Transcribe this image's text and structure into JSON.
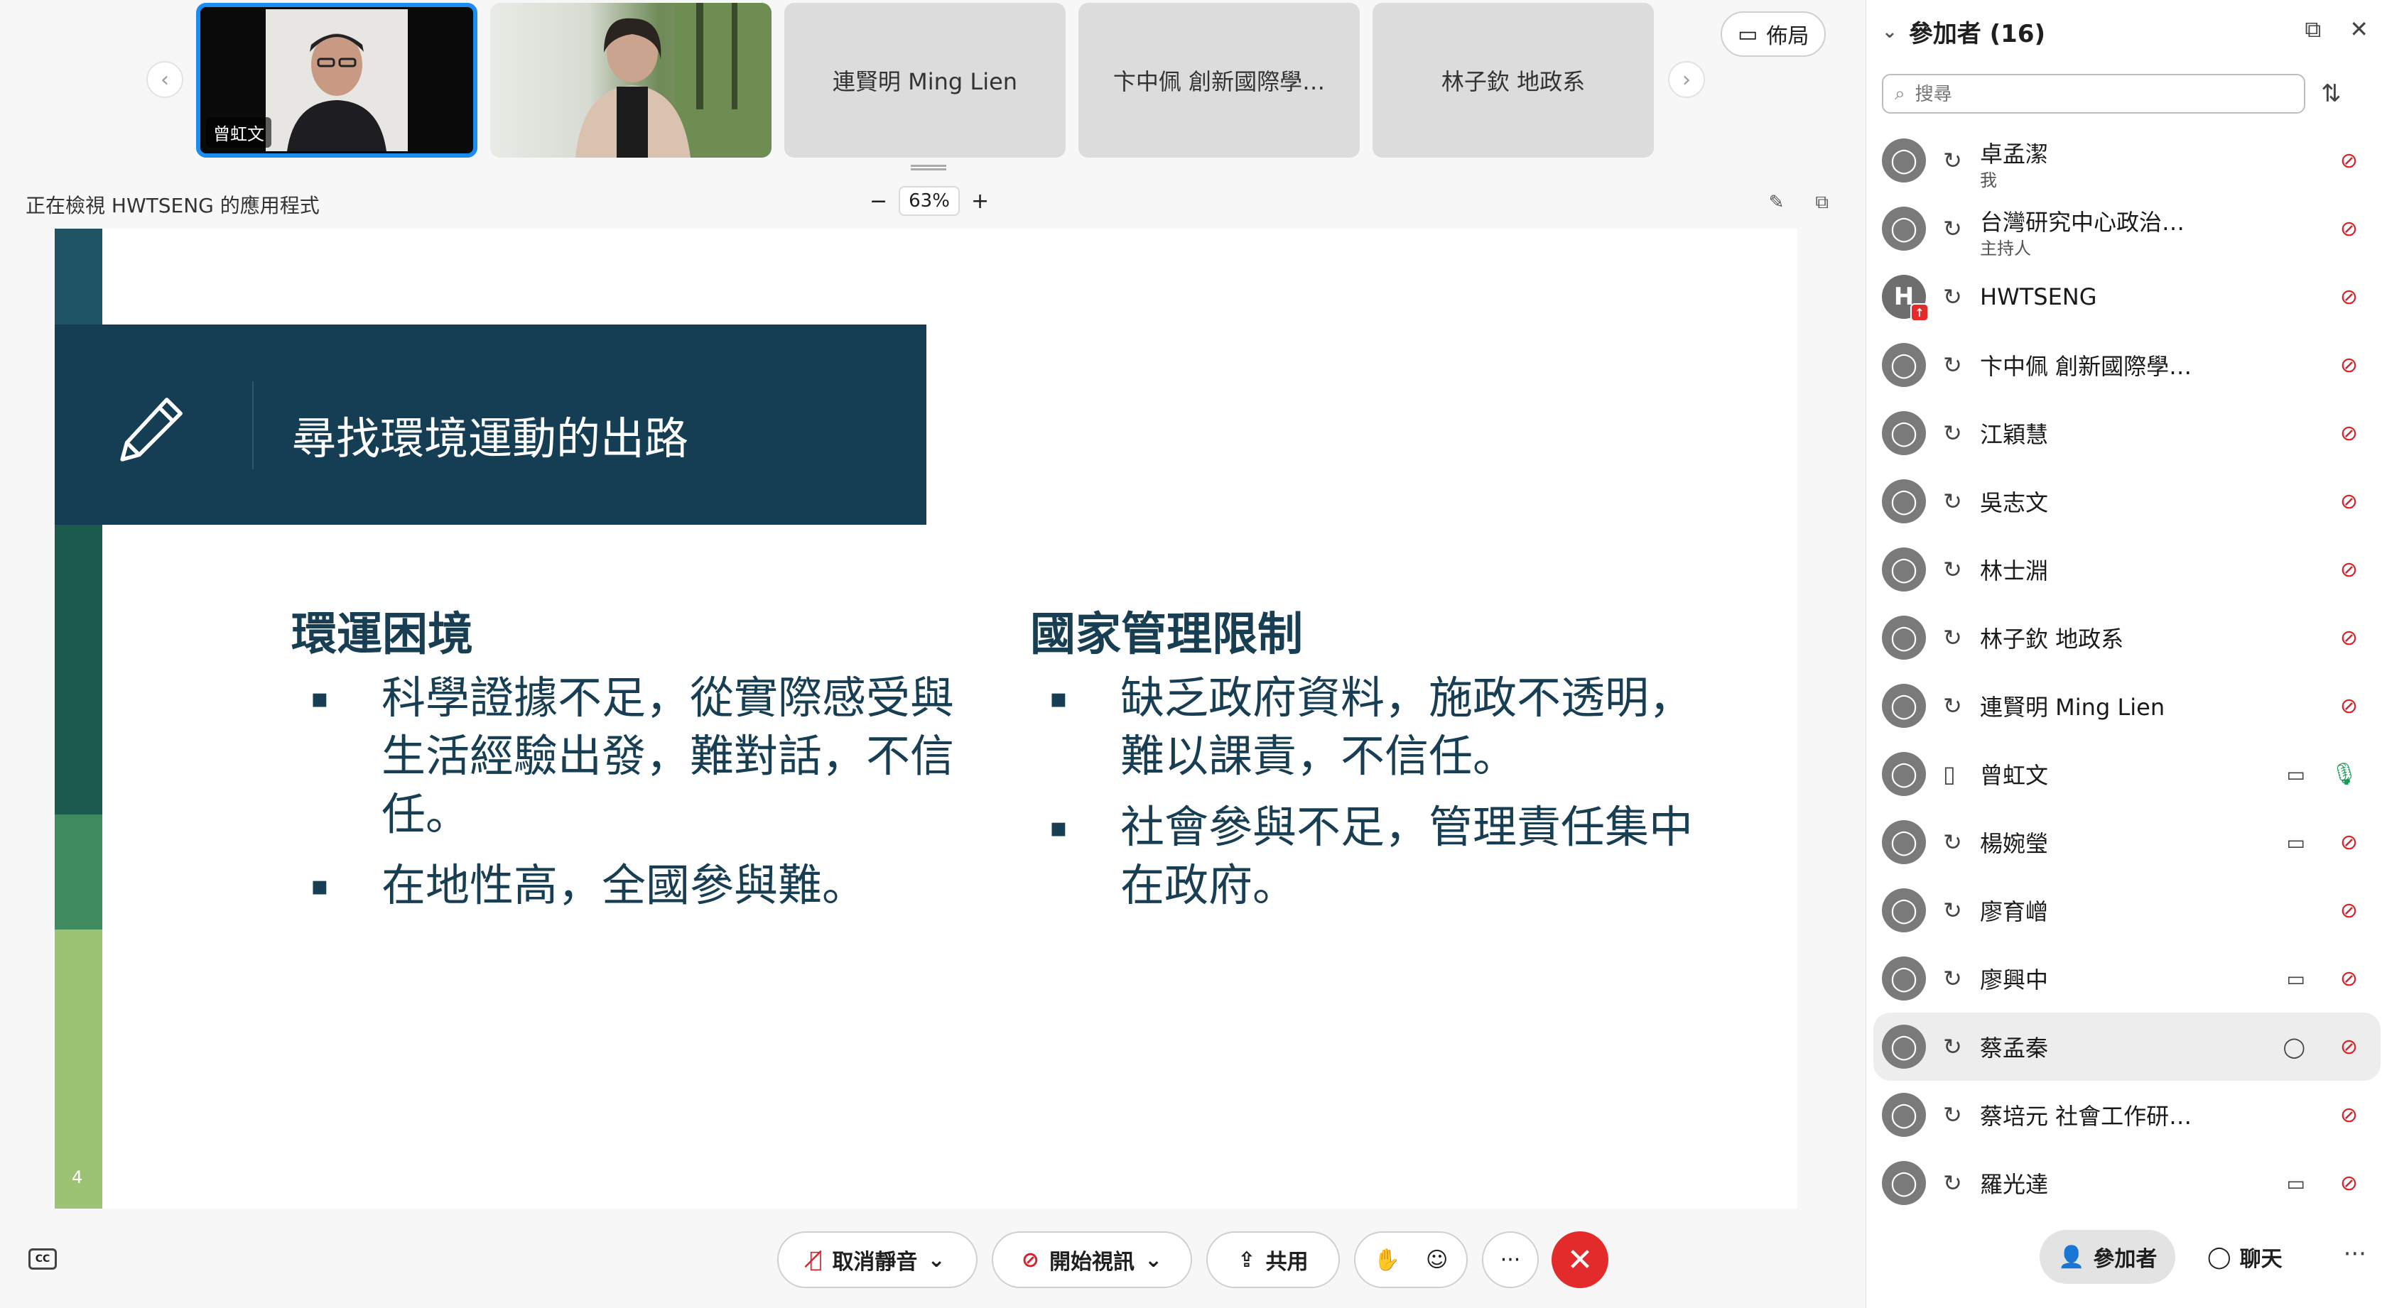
{
  "strip": {
    "tiles": [
      {
        "name": "曾虹文"
      },
      {
        "name": ""
      },
      {
        "name": "連賢明 Ming Lien"
      },
      {
        "name": "卞中佩 創新國際學…"
      },
      {
        "name": "林子欽 地政系"
      }
    ],
    "layout_label": "佈局"
  },
  "share": {
    "viewing_text": "正在檢視 HWTSENG 的應用程式",
    "zoom": "63%"
  },
  "slide": {
    "title": "尋找環境運動的出路",
    "left_heading": "環運困境",
    "left_bullets": [
      "科學證據不足，從實際感受與生活經驗出發，難對話，不信任。",
      "在地性高，全國參與難。"
    ],
    "right_heading": "國家管理限制",
    "right_bullets": [
      "缺乏政府資料，施政不透明，難以課責，不信任。",
      "社會參與不足，管理責任集中在政府。"
    ],
    "page_number": "4",
    "colors": {
      "navy": "#153e55",
      "teal_dark": "#1f5466",
      "green_dark": "#1d5a4e",
      "green_mid": "#3f8a5e",
      "green_light": "#9cc274"
    }
  },
  "controls": {
    "cc_label": "CC",
    "mute_label": "取消靜音",
    "video_label": "開始視訊",
    "share_label": "共用",
    "more_label": "···"
  },
  "panel": {
    "title": "參加者 (16)",
    "search_placeholder": "搜尋",
    "participants": [
      {
        "name": "卓孟潔",
        "sub": "我"
      },
      {
        "name": "台灣研究中心政治…",
        "sub": "主持人"
      },
      {
        "name": "HWTSENG",
        "avatar_letter": "H"
      },
      {
        "name": "卞中佩 創新國際學…"
      },
      {
        "name": "江穎慧"
      },
      {
        "name": "吳志文"
      },
      {
        "name": "林士淵"
      },
      {
        "name": "林子欽 地政系"
      },
      {
        "name": "連賢明 Ming Lien"
      },
      {
        "name": "曾虹文"
      },
      {
        "name": "楊婉瑩"
      },
      {
        "name": "廖育嶒"
      },
      {
        "name": "廖興中"
      },
      {
        "name": "蔡孟秦"
      },
      {
        "name": "蔡培元 社會工作研…"
      },
      {
        "name": "羅光達"
      }
    ],
    "tab_participants": "參加者",
    "tab_chat": "聊天",
    "more": "···"
  }
}
